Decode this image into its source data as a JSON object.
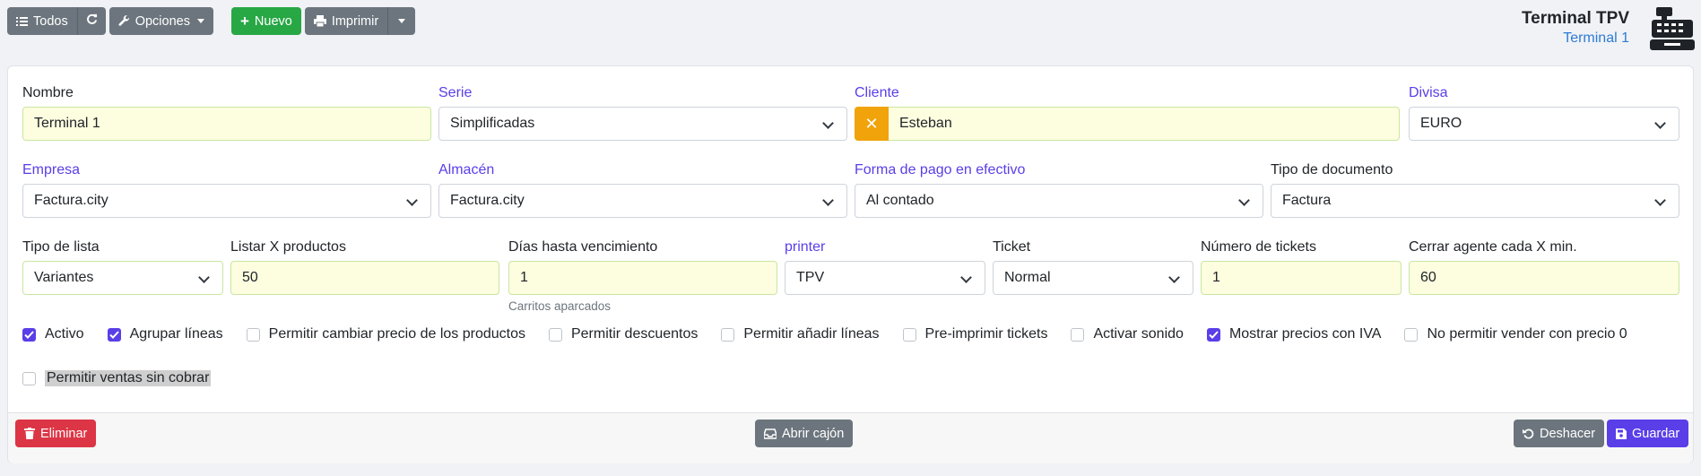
{
  "toolbar": {
    "all_label": "Todos",
    "options_label": "Opciones",
    "new_label": "Nuevo",
    "print_label": "Imprimir"
  },
  "header": {
    "title": "Terminal TPV",
    "subtitle": "Terminal 1"
  },
  "form": {
    "row1": {
      "nombre": {
        "label": "Nombre",
        "value": "Terminal 1"
      },
      "serie": {
        "label": "Serie",
        "value": "Simplificadas"
      },
      "cliente": {
        "label": "Cliente",
        "value": "Esteban"
      },
      "divisa": {
        "label": "Divisa",
        "value": "EURO"
      }
    },
    "row2": {
      "empresa": {
        "label": "Empresa",
        "value": "Factura.city"
      },
      "almacen": {
        "label": "Almacén",
        "value": "Factura.city"
      },
      "forma_pago": {
        "label": "Forma de pago en efectivo",
        "value": "Al contado"
      },
      "tipo_documento": {
        "label": "Tipo de documento",
        "value": "Factura"
      }
    },
    "row3": {
      "tipo_lista": {
        "label": "Tipo de lista",
        "value": "Variantes"
      },
      "listar_productos": {
        "label": "Listar X productos",
        "value": "50"
      },
      "dias_vencimiento": {
        "label": "Días hasta vencimiento",
        "value": "1",
        "help": "Carritos aparcados"
      },
      "printer": {
        "label": "printer",
        "value": "TPV"
      },
      "ticket": {
        "label": "Ticket",
        "value": "Normal"
      },
      "num_tickets": {
        "label": "Número de tickets",
        "value": "1"
      },
      "cerrar_agente": {
        "label": "Cerrar agente cada X min.",
        "value": "60"
      }
    },
    "checkboxes": [
      {
        "label": "Activo",
        "checked": true
      },
      {
        "label": "Agrupar líneas",
        "checked": true
      },
      {
        "label": "Permitir cambiar precio de los productos",
        "checked": false
      },
      {
        "label": "Permitir descuentos",
        "checked": false
      },
      {
        "label": "Permitir añadir líneas",
        "checked": false
      },
      {
        "label": "Pre-imprimir tickets",
        "checked": false
      },
      {
        "label": "Activar sonido",
        "checked": false
      },
      {
        "label": "Mostrar precios con IVA",
        "checked": true
      },
      {
        "label": "No permitir vender con precio 0",
        "checked": false
      }
    ],
    "ventas_sin_cobrar": {
      "label": "Permitir ventas sin cobrar",
      "checked": false
    }
  },
  "footer": {
    "delete_label": "Eliminar",
    "open_drawer_label": "Abrir cajón",
    "undo_label": "Deshacer",
    "save_label": "Guardar"
  },
  "colors": {
    "primary": "#5a3ee8",
    "secondary": "#6c757d",
    "success": "#28a745",
    "danger": "#dc3545",
    "warning": "#f0a30a",
    "field_bg": "#fdfde0"
  }
}
